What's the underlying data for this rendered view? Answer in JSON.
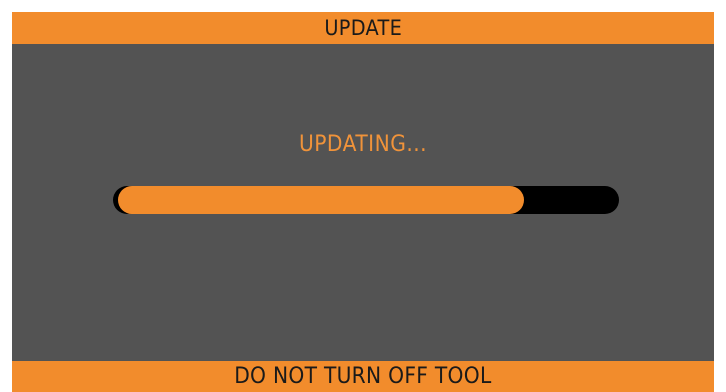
{
  "header": {
    "title": "UPDATE"
  },
  "status": {
    "text": "UPDATING..."
  },
  "progress": {
    "fraction": 0.81
  },
  "footer": {
    "warning": "DO NOT TURN OFF TOOL"
  },
  "colors": {
    "accent": "#f28c2c",
    "background": "#535353",
    "track": "#000000",
    "status_text": "#f0933a"
  }
}
